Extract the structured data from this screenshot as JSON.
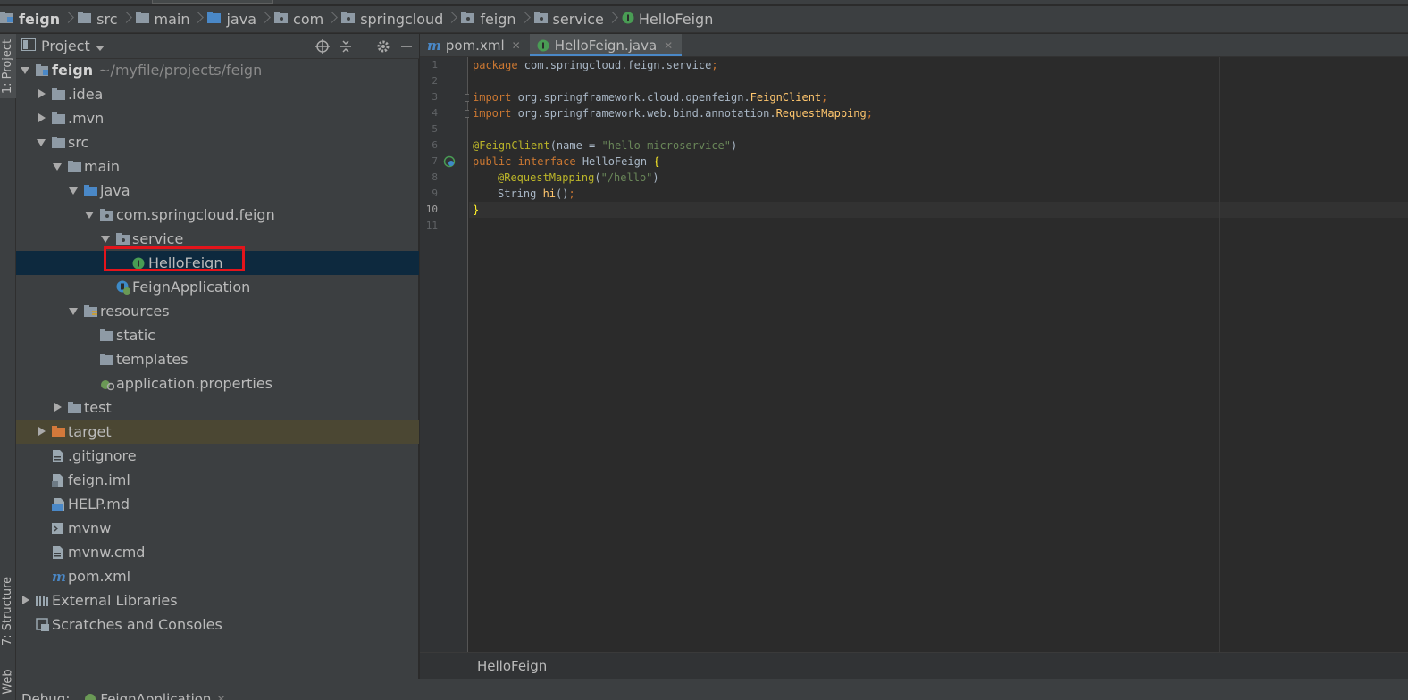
{
  "breadcrumb": [
    "feign",
    "src",
    "main",
    "java",
    "com",
    "springcloud",
    "feign",
    "service",
    "HelloFeign"
  ],
  "side_tabs": {
    "project": "1: Project",
    "structure": "7: Structure",
    "web": "Web"
  },
  "panel": {
    "title": "Project"
  },
  "tree": [
    {
      "label": "feign",
      "hint": "~/myfile/projects/feign"
    },
    {
      "label": ".idea"
    },
    {
      "label": ".mvn"
    },
    {
      "label": "src"
    },
    {
      "label": "main"
    },
    {
      "label": "java"
    },
    {
      "label": "com.springcloud.feign"
    },
    {
      "label": "service"
    },
    {
      "label": "HelloFeign"
    },
    {
      "label": "FeignApplication"
    },
    {
      "label": "resources"
    },
    {
      "label": "static"
    },
    {
      "label": "templates"
    },
    {
      "label": "application.properties"
    },
    {
      "label": "test"
    },
    {
      "label": "target"
    },
    {
      "label": ".gitignore"
    },
    {
      "label": "feign.iml"
    },
    {
      "label": "HELP.md"
    },
    {
      "label": "mvnw"
    },
    {
      "label": "mvnw.cmd"
    },
    {
      "label": "pom.xml"
    },
    {
      "label": "External Libraries"
    },
    {
      "label": "Scratches and Consoles"
    }
  ],
  "editor": {
    "tabs": [
      "pom.xml",
      "HelloFeign.java"
    ],
    "line_numbers": [
      "1",
      "2",
      "3",
      "4",
      "5",
      "6",
      "7",
      "8",
      "9",
      "10",
      "11"
    ],
    "code": {
      "l1_kw": "package",
      "l1_rest": " com.springcloud.feign.service",
      "l1_end": ";",
      "l3_kw": "import",
      "l3_rest": " org.springframework.cloud.openfeign.",
      "l3_cls": "FeignClient",
      "l3_end": ";",
      "l4_kw": "import",
      "l4_rest": " org.springframework.web.bind.annotation.",
      "l4_cls": "RequestMapping",
      "l4_end": ";",
      "l6_ann": "@FeignClient",
      "l6_a": "(name = ",
      "l6_str": "\"hello-microservice\"",
      "l6_b": ")",
      "l7_kw": "public interface",
      "l7_name": " HelloFeign ",
      "l7_brace": "{",
      "l8_ann": "@RequestMapping",
      "l8_a": "(",
      "l8_str": "\"/hello\"",
      "l8_b": ")",
      "l9_type": "String ",
      "l9_fn": "hi",
      "l9_rest": "()",
      "l9_end": ";",
      "l10_brace": "}"
    },
    "footer": "HelloFeign"
  },
  "debug": {
    "label": "Debug:",
    "tab": "FeignApplication"
  }
}
